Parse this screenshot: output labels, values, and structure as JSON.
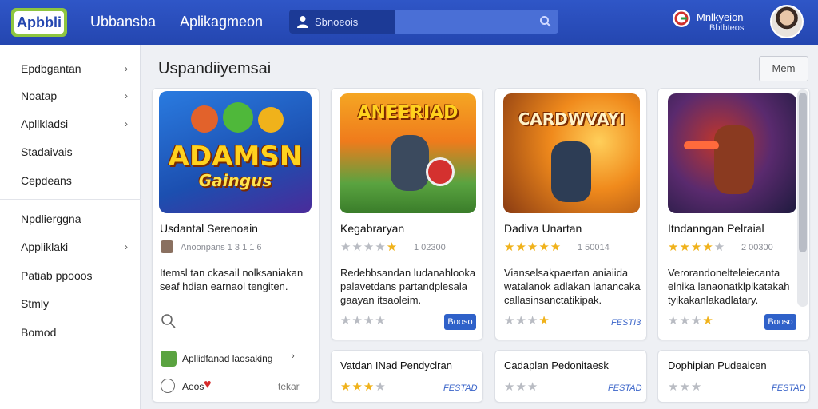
{
  "header": {
    "logo": "Apbbli",
    "nav": [
      "Ubbansba",
      "Aplikagmeon"
    ],
    "search_label": "Sbnoeois",
    "brand_line1": "Mnlkyeion",
    "brand_line2": "Bbtbteos"
  },
  "sidebar": {
    "items": [
      "Epdbgantan",
      "Noatap",
      "Apllkladsi",
      "Stadaivais",
      "Cepdeans",
      "Npdlierggna",
      "Appliklaki",
      "Patiab ppooos",
      "Stmly",
      "Bomod"
    ]
  },
  "main": {
    "title": "Uspandiiyemsai",
    "more_button": "Mem",
    "cards": [
      {
        "thumb_label": "ADAMSN",
        "thumb_sublabel": "Gaingus",
        "title": "Usdantal Serenoain",
        "rating_text": "Anoonpans 1 3 1 1 6",
        "description": [
          "Itemsl tan ckasail nolksaniakan",
          "seaf hdian earnaol tengiten."
        ],
        "footer_row1": "Apllidfanad laosaking",
        "footer_row2_left": "Aeos",
        "footer_row2_right": "tekar"
      },
      {
        "thumb_label": "ANEERIAD",
        "title": "Kegabraryan",
        "rating_num": "1 02300",
        "description": [
          "Redebbsandan ludanahlooka",
          "palavetdans partandplesala",
          "gaayan itsaoleim."
        ],
        "badge": "Booso"
      },
      {
        "thumb_label": "CARDWVAYI",
        "title": "Dadiva Unartan",
        "rating_num": "1 50014",
        "description": [
          "Vianselsakpaertan aniaiida",
          "watalanok adlakan lanancaka",
          "callasinsanctatikipak."
        ],
        "badge": "FESTI3"
      },
      {
        "title": "Itndanngan Pelraial",
        "rating_num": "2 00300",
        "description": [
          "Verorandonelteleiecanta",
          "elnika lanaonatklplkatakah",
          "tyikakanlakadlatary."
        ],
        "badge": "Booso"
      }
    ],
    "mini_cards": [
      {
        "title": "Vatdan INad Pendyclran",
        "badge": "FESTAD"
      },
      {
        "title": "Cadaplan Pedonitaesk",
        "badge": "FESTAD"
      },
      {
        "title": "Dophipian Pudeaicen",
        "badge": "FESTAD"
      }
    ]
  }
}
